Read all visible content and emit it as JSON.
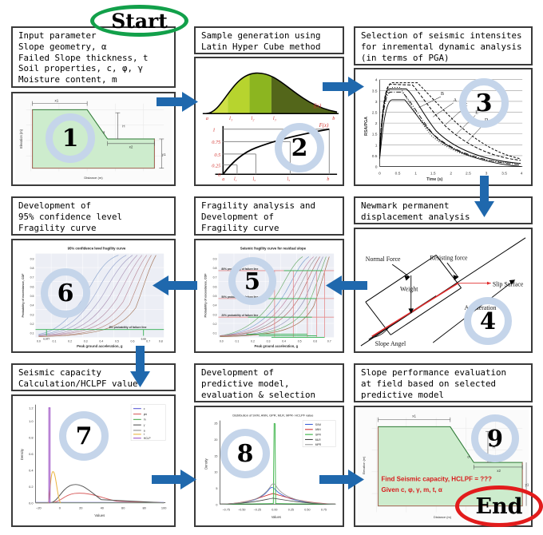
{
  "terminators": {
    "start": "Start",
    "end": "End"
  },
  "accents": {
    "arrow_blue": "#1f68ad",
    "start_green": "#12a04a",
    "end_red": "#e21c1c",
    "badge_ring": "#c5d5ea",
    "box_border": "#3a3a3a",
    "slope_fill": "#cdeccd",
    "slope_line": "#2f7a36"
  },
  "steps": [
    {
      "number": "1",
      "caption": "Input parameter\nSlope geometry, α\nFailed Slope thickness, t\nSoil properties, c, φ, γ\nMoisture content, m",
      "figure": {
        "kind": "slope-geometry",
        "axis_x": "Distance (m)",
        "axis_y": "Elevation (m)",
        "labels": [
          "x1",
          "x2",
          "H",
          "y1",
          "α"
        ]
      }
    },
    {
      "number": "2",
      "caption": "Sample generation using\nLatin Hyper Cube method",
      "figure": {
        "kind": "lhc-pdf-cdf",
        "pdf_label": "f(x)",
        "cdf_label": "F(x)",
        "x_ticks": [
          "a",
          "l₁",
          "l₂",
          "l₃",
          "b"
        ],
        "y_ticks": [
          "0",
          "0.25",
          "0.5",
          "0.75",
          "1"
        ]
      }
    },
    {
      "number": "3",
      "caption": "Selection of seismic intensites\nfor inremental dynamic analysis\n(in terms of PGA)",
      "figure": {
        "kind": "response-spectra",
        "ylabel": "RSA/PGA",
        "xlabel": "Time (s)",
        "x_ticks": [
          "0",
          "0.5",
          "1",
          "1.5",
          "2",
          "2.5",
          "3",
          "3.5",
          "4"
        ],
        "y_ticks": [
          "0",
          "0.5",
          "1",
          "1.5",
          "2",
          "2.5",
          "3",
          "3.5",
          "4"
        ],
        "curve_labels": [
          "A",
          "B",
          "C",
          "D",
          "E"
        ]
      }
    },
    {
      "number": "4",
      "caption": "Newmark permanent\ndisplacement analysis",
      "figure": {
        "kind": "free-body-slope",
        "labels": [
          "Normal Force",
          "Resisting force",
          "Slip Surface",
          "Weight",
          "Acceleration",
          "Slope Angel"
        ]
      }
    },
    {
      "number": "5",
      "caption": "Fragility analysis and\nDevelopment of\nFragility curve",
      "figure": {
        "kind": "fragility-residual",
        "title": "Seismic fragility curve for residual slope",
        "ylabel": "Probability of exceedance, CDF",
        "xlabel": "Peak ground acceleration, g",
        "annotations": [
          "80% probability of failure line",
          "50% probability of failure line",
          "20% probability of failure line"
        ]
      }
    },
    {
      "number": "6",
      "caption": "Development of\n95% confidence level\nFragility curve",
      "figure": {
        "kind": "fragility-confidence",
        "title": "95% confidence level fragility curve",
        "ylabel": "Probability of exceedance, CDF",
        "xlabel": "Peak ground acceleration, g",
        "annotations": [
          "5% probability of failure line",
          "0.077",
          "0.69"
        ]
      }
    },
    {
      "number": "7",
      "caption": "Seismic capacity\nCalculation/HCLPF value",
      "figure": {
        "kind": "density-inputs",
        "ylabel": "Density",
        "xlabel": "Values",
        "x_ticks": [
          "-20",
          "0",
          "20",
          "40",
          "60",
          "80",
          "100"
        ],
        "y_ticks": [
          "0.0",
          "0.2",
          "0.4",
          "0.6",
          "0.8",
          "1.0",
          "1.2"
        ],
        "legend": [
          "c",
          "phi",
          "m",
          "γ",
          "a",
          "t",
          "HCLP"
        ]
      }
    },
    {
      "number": "8",
      "caption": "Development of\npredictive model,\nevaluation & selection",
      "figure": {
        "kind": "density-models",
        "title": "Distribution of SVM, ANN, GPR, MLR, MPR- HCLPF value",
        "ylabel": "Density",
        "xlabel": "Values",
        "x_ticks": [
          "-0.75",
          "-0.50",
          "-0.25",
          "0.00",
          "0.25",
          "0.50",
          "0.75"
        ],
        "y_ticks": [
          "0",
          "5",
          "10",
          "15",
          "20",
          "25"
        ],
        "legend": [
          "SVM",
          "ANN",
          "GPR",
          "MLR",
          "MPR"
        ]
      }
    },
    {
      "number": "9",
      "caption": "Slope performance evaluation\nat field based on selected\npredictive model",
      "figure": {
        "kind": "slope-geometry-query",
        "axis_x": "Distance (m)",
        "axis_y": "Elevation (m)",
        "labels": [
          "x1",
          "x2",
          "H",
          "y1",
          "α"
        ],
        "query_line1": "Find Seismic capacity, HCLPF = ???",
        "query_line2": "Given c, φ, γ, m, t, α"
      }
    }
  ],
  "arrows": [
    {
      "name": "arrow-1-to-2",
      "direction": "right"
    },
    {
      "name": "arrow-2-to-3",
      "direction": "right"
    },
    {
      "name": "arrow-3-to-4",
      "direction": "down"
    },
    {
      "name": "arrow-4-to-5",
      "direction": "left"
    },
    {
      "name": "arrow-5-to-6",
      "direction": "left"
    },
    {
      "name": "arrow-6-to-7",
      "direction": "down"
    },
    {
      "name": "arrow-7-to-8",
      "direction": "right"
    },
    {
      "name": "arrow-8-to-9",
      "direction": "right"
    }
  ]
}
